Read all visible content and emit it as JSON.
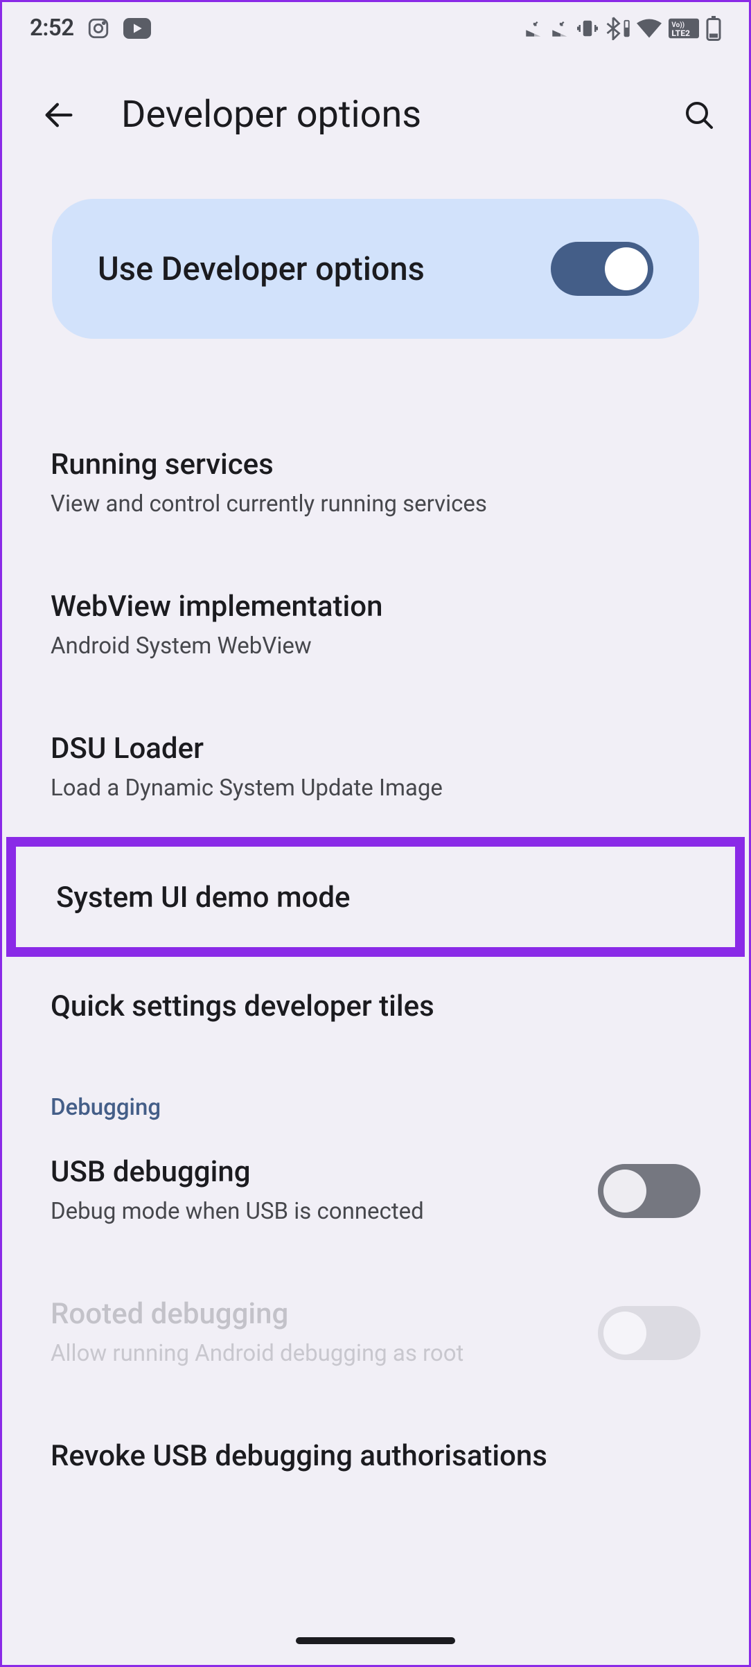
{
  "status": {
    "time": "2:52"
  },
  "header": {
    "title": "Developer options"
  },
  "master": {
    "label": "Use Developer options",
    "on": true
  },
  "section_debugging": "Debugging",
  "items": {
    "running_services": {
      "title": "Running services",
      "sub": "View and control currently running services"
    },
    "webview": {
      "title": "WebView implementation",
      "sub": "Android System WebView"
    },
    "dsu": {
      "title": "DSU Loader",
      "sub": "Load a Dynamic System Update Image"
    },
    "demo": {
      "title": "System UI demo mode"
    },
    "qs_tiles": {
      "title": "Quick settings developer tiles"
    },
    "usb_debug": {
      "title": "USB debugging",
      "sub": "Debug mode when USB is connected",
      "on": false
    },
    "rooted_debug": {
      "title": "Rooted debugging",
      "sub": "Allow running Android debugging as root",
      "on": false,
      "disabled": true
    },
    "revoke": {
      "title": "Revoke USB debugging authorisations"
    }
  }
}
